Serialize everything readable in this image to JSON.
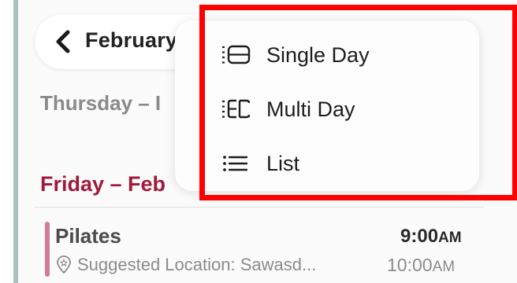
{
  "header": {
    "month_label": "February",
    "back_icon": "chevron-left-icon"
  },
  "days": [
    {
      "label": "Thursday – I",
      "color": "#8a8a8a"
    },
    {
      "label": "Friday – Feb",
      "color": "#9e1b3c"
    }
  ],
  "event": {
    "title": "Pilates",
    "start": "9:00",
    "start_ampm": "AM",
    "location": "Suggested Location: Sawasd...",
    "end": "10:00",
    "end_ampm": "AM",
    "accent_color": "#d87a97"
  },
  "view_menu": {
    "items": [
      {
        "label": "Single Day",
        "icon": "single-day-view-icon"
      },
      {
        "label": "Multi Day",
        "icon": "multi-day-view-icon"
      },
      {
        "label": "List",
        "icon": "list-view-icon"
      }
    ]
  },
  "highlight": {
    "color": "#ff0000"
  }
}
